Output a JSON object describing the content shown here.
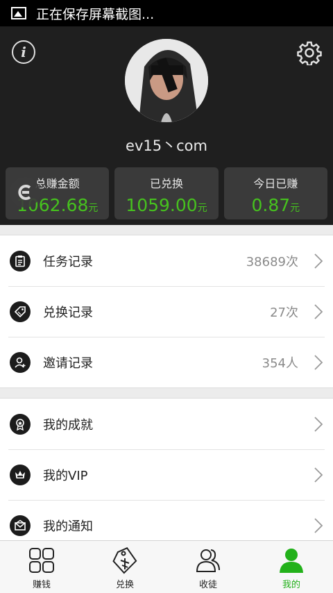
{
  "statusbar": {
    "text": "正在保存屏幕截图..."
  },
  "profile": {
    "username": "ev15丶com"
  },
  "stats": [
    {
      "label": "总赚金额",
      "value": "1062.68",
      "unit": "元"
    },
    {
      "label": "已兑换",
      "value": "1059.00",
      "unit": "元"
    },
    {
      "label": "今日已赚",
      "value": "0.87",
      "unit": "元"
    }
  ],
  "records": [
    {
      "label": "任务记录",
      "count": "38689次",
      "icon": "clipboard-icon"
    },
    {
      "label": "兑换记录",
      "count": "27次",
      "icon": "tag-icon"
    },
    {
      "label": "邀请记录",
      "count": "354人",
      "icon": "user-add-icon"
    }
  ],
  "mine": [
    {
      "label": "我的成就",
      "icon": "medal-icon"
    },
    {
      "label": "我的VIP",
      "icon": "crown-icon"
    },
    {
      "label": "我的通知",
      "icon": "envelope-icon"
    }
  ],
  "tabs": [
    {
      "label": "赚钱",
      "icon": "grid-icon"
    },
    {
      "label": "兑换",
      "icon": "coupon-icon"
    },
    {
      "label": "收徒",
      "icon": "people-icon"
    },
    {
      "label": "我的",
      "icon": "person-icon"
    }
  ],
  "colors": {
    "accent": "#22b11a",
    "value_green": "#46c21e",
    "header_bg": "#1f1f1f",
    "stat_bg": "#3a3a3a"
  }
}
